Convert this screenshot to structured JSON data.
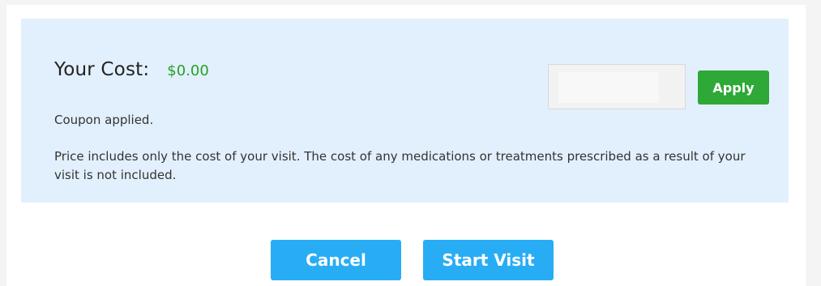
{
  "cost": {
    "label": "Your Cost:",
    "value": "$0.00",
    "value_color": "#25a025"
  },
  "coupon": {
    "status": "Coupon applied.",
    "input_value": "",
    "apply_label": "Apply",
    "apply_color": "#2ea836"
  },
  "notice": {
    "text": "Price includes only the cost of your visit. The cost of any medications or treatments prescribed as a result of your visit is not included."
  },
  "actions": {
    "cancel_label": "Cancel",
    "start_label": "Start Visit",
    "button_color": "#28adf5"
  },
  "panel": {
    "background_color": "#e2f0fd"
  }
}
